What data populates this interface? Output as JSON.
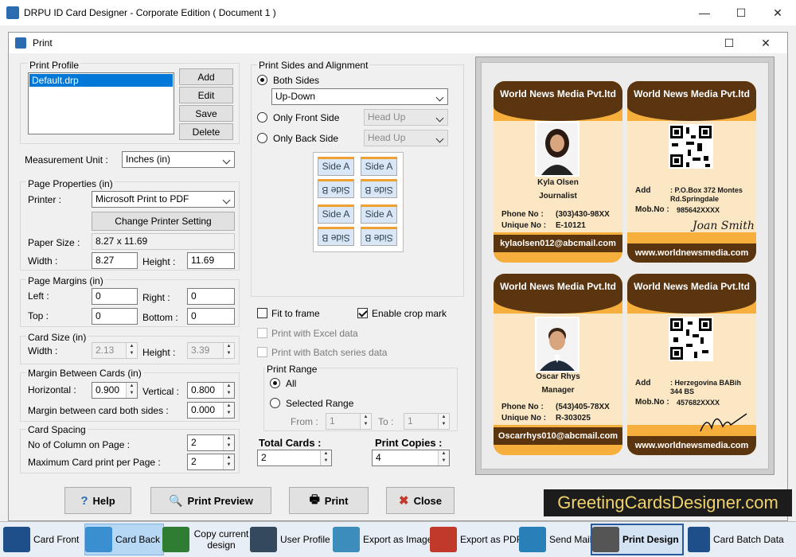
{
  "app": {
    "title": "DRPU ID Card Designer - Corporate Edition ( Document 1 )"
  },
  "dialog": {
    "title": "Print",
    "print_profile": {
      "label": "Print Profile",
      "items": [
        "Default.drp"
      ],
      "add": "Add",
      "edit": "Edit",
      "save": "Save",
      "delete": "Delete"
    },
    "measurement": {
      "label": "Measurement Unit :",
      "value": "Inches (in)"
    },
    "page_properties": {
      "label": "Page Properties (in)",
      "printer_label": "Printer :",
      "printer": "Microsoft Print to PDF",
      "change_printer": "Change Printer Setting",
      "paper_size_label": "Paper Size :",
      "paper_size": "8.27 x 11.69",
      "width_label": "Width :",
      "width": "8.27",
      "height_label": "Height :",
      "height": "11.69"
    },
    "page_margins": {
      "label": "Page Margins (in)",
      "left_label": "Left :",
      "left": "0",
      "right_label": "Right :",
      "right": "0",
      "top_label": "Top :",
      "top": "0",
      "bottom_label": "Bottom :",
      "bottom": "0"
    },
    "card_size": {
      "label": "Card Size (in)",
      "width_label": "Width :",
      "width": "2.13",
      "height_label": "Height :",
      "height": "3.39"
    },
    "margin_between": {
      "label": "Margin Between Cards (in)",
      "horizontal_label": "Horizontal :",
      "horizontal": "0.900",
      "vertical_label": "Vertical :",
      "vertical": "0.800",
      "both_label": "Margin between card both sides :",
      "both": "0.000"
    },
    "card_spacing": {
      "label": "Card Spacing",
      "columns_label": "No of Column on Page :",
      "columns": "2",
      "max_label": "Maximum Card print per Page :",
      "max": "2"
    },
    "sides": {
      "label": "Print Sides and Alignment",
      "both": "Both Sides",
      "both_value": "Up-Down",
      "front": "Only Front Side",
      "front_value": "Head Up",
      "back": "Only Back Side",
      "back_value": "Head Up",
      "side_a": "Side A",
      "side_b": "Side B"
    },
    "options": {
      "fit": "Fit to frame",
      "crop": "Enable crop mark",
      "excel": "Print with Excel data",
      "batch": "Print with Batch series data"
    },
    "print_range": {
      "label": "Print Range",
      "all": "All",
      "selected": "Selected Range",
      "from_label": "From :",
      "from": "1",
      "to_label": "To :",
      "to": "1"
    },
    "totals": {
      "total_label": "Total Cards :",
      "total": "2",
      "copies_label": "Print Copies :",
      "copies": "4"
    },
    "buttons": {
      "help": "Help",
      "preview": "Print Preview",
      "print": "Print",
      "close": "Close"
    }
  },
  "cards": {
    "company": "World News Media Pvt.ltd",
    "website": "www.worldnewsmedia.com",
    "card1": {
      "name": "Kyla Olsen",
      "role": "Journalist",
      "phone_label": "Phone No :",
      "phone": "(303)430-98XX",
      "unique_label": "Unique No :",
      "unique": "E-10121",
      "email": "kylaolsen012@abcmail.com"
    },
    "card1_back": {
      "add_label": "Add",
      "add": ": P.O.Box 372 Montes Rd.Springdale",
      "mob_label": "Mob.No :",
      "mob": "985642XXXX",
      "signature": "Joan Smith"
    },
    "card2": {
      "name": "Oscar Rhys",
      "role": "Manager",
      "phone_label": "Phone No :",
      "phone": "(543)405-78XX",
      "unique_label": "Unique No :",
      "unique": "R-303025",
      "email": "Oscarrhys010@abcmail.com"
    },
    "card2_back": {
      "add_label": "Add",
      "add": ": Herzegovina BABih 344 BS",
      "mob_label": "Mob.No :",
      "mob": "457682XXXX"
    }
  },
  "watermark": "GreetingCardsDesigner.com",
  "taskbar": [
    "Card Front",
    "Card Back",
    "Copy current design",
    "User Profile",
    "Export as Image",
    "Export as PDF",
    "Send Mail",
    "Print Design",
    "Card Batch Data"
  ]
}
